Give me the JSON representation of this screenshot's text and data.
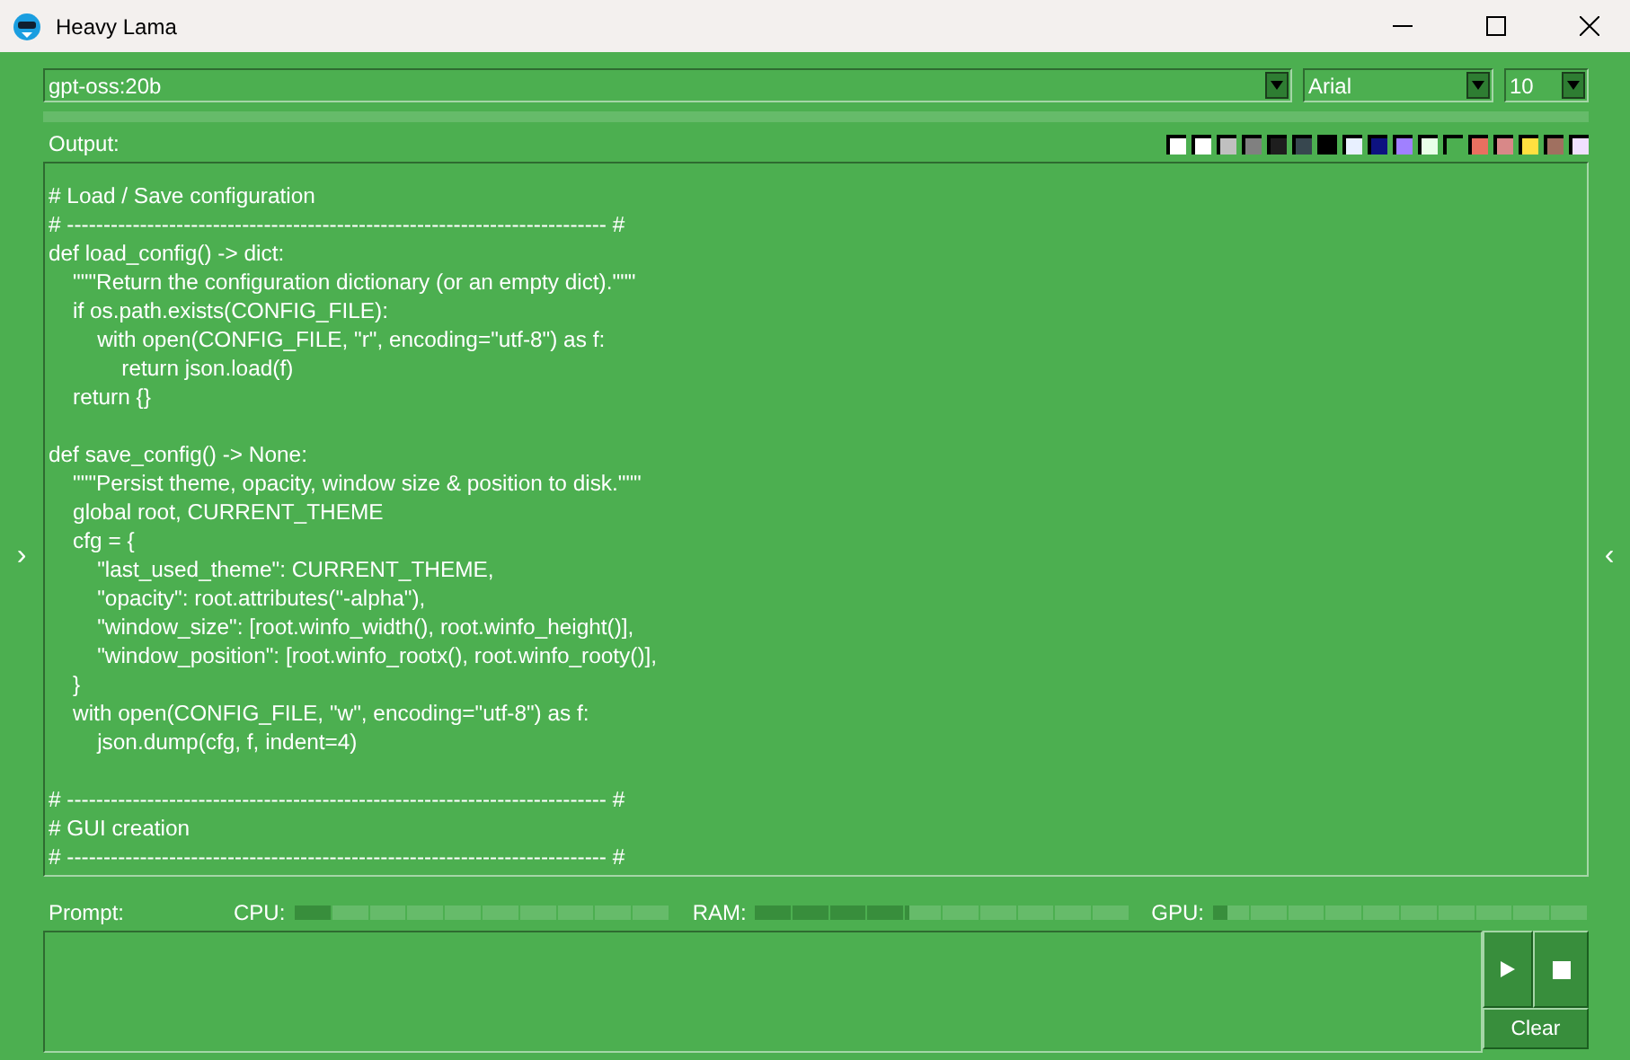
{
  "window": {
    "title": "Heavy Lama"
  },
  "model_select": {
    "value": "gpt-oss:20b"
  },
  "font_select": {
    "value": "Arial"
  },
  "size_select": {
    "value": "10"
  },
  "progress": {
    "level": 0
  },
  "output": {
    "label": "Output:",
    "swatches": [
      {
        "color": "#ffffff"
      },
      {
        "color": "#ffffff"
      },
      {
        "color": "#c0c0c0"
      },
      {
        "color": "#808080"
      },
      {
        "color": "#1e1e1e"
      },
      {
        "color": "#37474f"
      },
      {
        "color": "#000000"
      },
      {
        "color": "#e8f0ff"
      },
      {
        "color": "#0d1280"
      },
      {
        "color": "#a080ff"
      },
      {
        "color": "#e8ffe8"
      },
      {
        "color": "#4caf50"
      },
      {
        "color": "#e87060"
      },
      {
        "color": "#d88888"
      },
      {
        "color": "#ffe040"
      },
      {
        "color": "#a07060"
      },
      {
        "color": "#f0e0ff"
      }
    ],
    "blocks": [
      [
        "# Load / Save configuration",
        "# -------------------------------------------------------------------------- #",
        "def load_config() -> dict:",
        "    \"\"\"Return the configuration dictionary (or an empty dict).\"\"\"",
        "    if os.path.exists(CONFIG_FILE):",
        "        with open(CONFIG_FILE, \"r\", encoding=\"utf-8\") as f:",
        "            return json.load(f)",
        "    return {}"
      ],
      [
        "def save_config() -> None:",
        "    \"\"\"Persist theme, opacity, window size & position to disk.\"\"\"",
        "    global root, CURRENT_THEME",
        "    cfg = {",
        "        \"last_used_theme\": CURRENT_THEME,",
        "        \"opacity\": root.attributes(\"-alpha\"),",
        "        \"window_size\": [root.winfo_width(), root.winfo_height()],",
        "        \"window_position\": [root.winfo_rootx(), root.winfo_rooty()],",
        "    }",
        "    with open(CONFIG_FILE, \"w\", encoding=\"utf-8\") as f:",
        "        json.dump(cfg, f, indent=4)"
      ],
      [
        "# -------------------------------------------------------------------------- #",
        "# GUI creation",
        "# -------------------------------------------------------------------------- #"
      ]
    ]
  },
  "side_arrows": {
    "left": "›",
    "right": "‹"
  },
  "prompt": {
    "label": "Prompt:"
  },
  "meters": [
    {
      "label": "CPU:",
      "level": 0.1
    },
    {
      "label": "RAM:",
      "level": 0.41
    },
    {
      "label": "GPU:",
      "level": 0.04
    }
  ],
  "buttons": [
    {
      "kind": "play"
    },
    {
      "kind": "stop"
    },
    {
      "kind": "text",
      "label": "Clear"
    }
  ]
}
